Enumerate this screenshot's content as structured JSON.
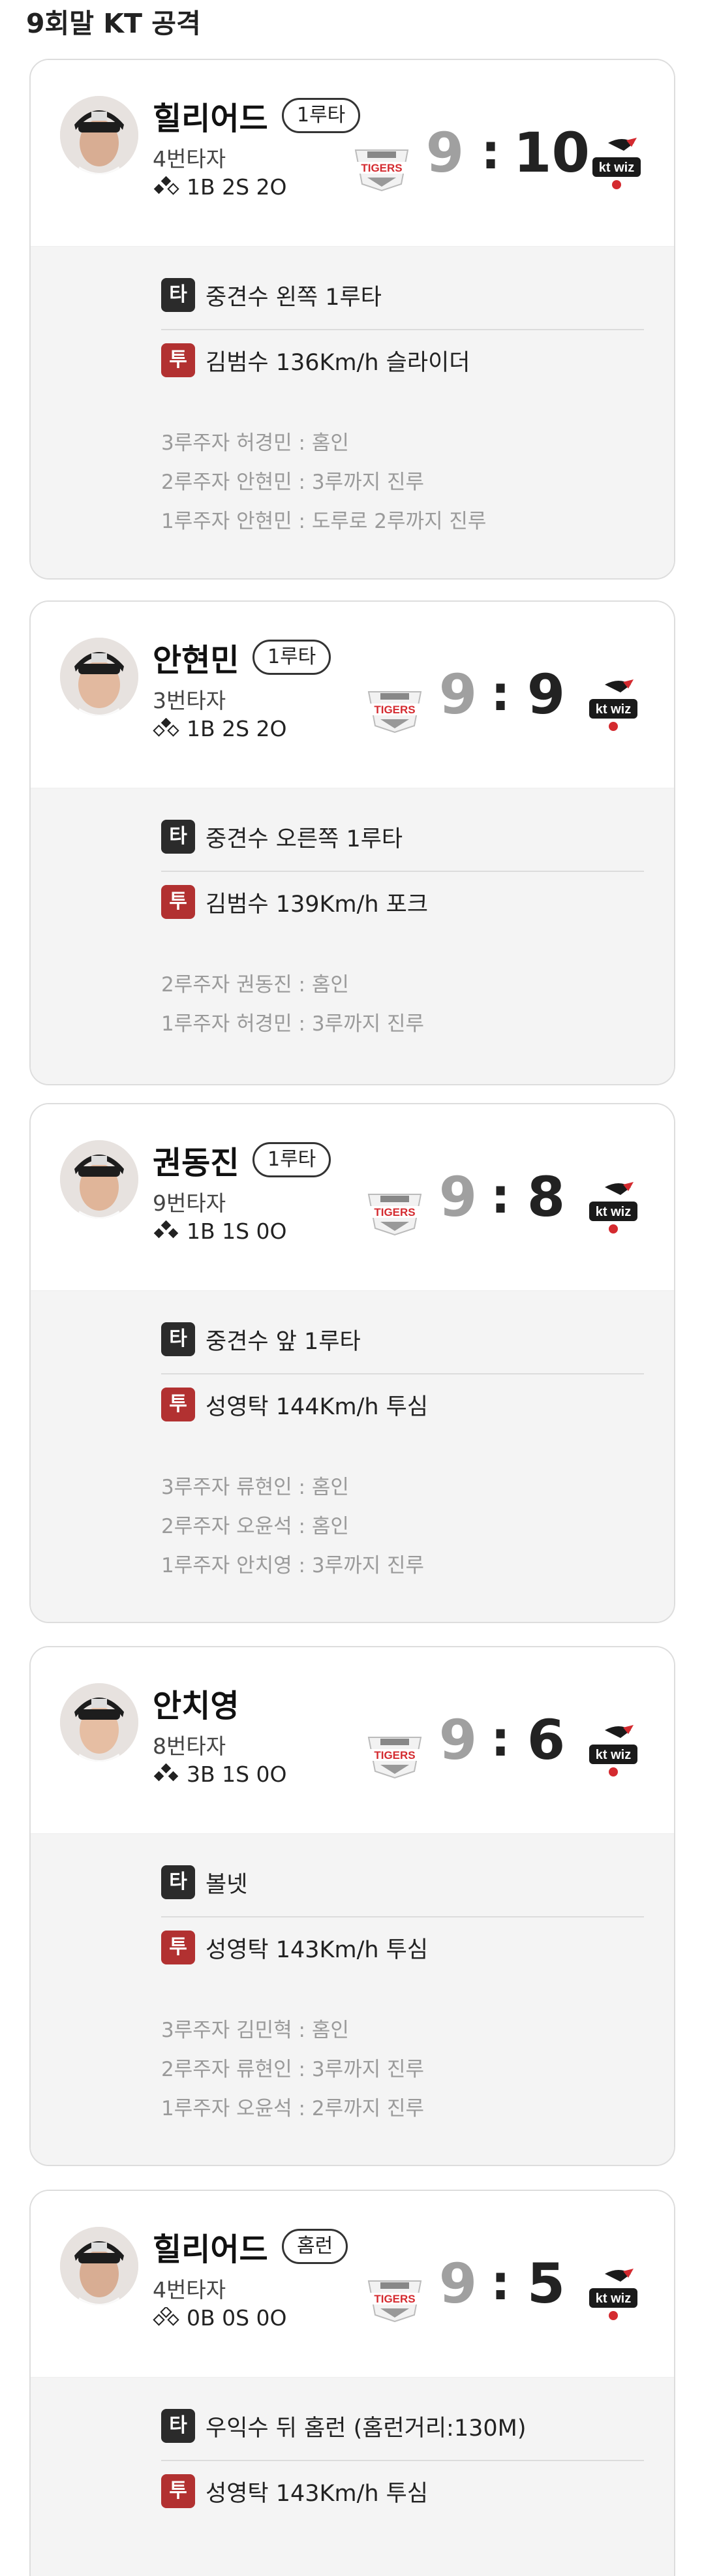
{
  "section_title": "9회말 KT 공격",
  "colors": {
    "pitch_tag": "#b23131",
    "bat_tag": "#2b2b2b",
    "home_score": "#a0a0a0",
    "away_score": "#222222",
    "tigers_red": "#d42a2f",
    "ktwiz_black": "#1a1a1a"
  },
  "cards": [
    {
      "player": "힐리어드",
      "result": "1루타",
      "order": "4번타자",
      "count": "1B 2S 2O",
      "score_home": "9",
      "score_away": "10",
      "colon": ":",
      "bat_tag": "타",
      "bat_text": "중견수 왼쪽 1루타",
      "pitch_tag": "투",
      "pitch_text": "김범수 136Km/h 슬라이더",
      "runners": [
        "3루주자 허경민 : 홈인",
        "2루주자 안현민 : 3루까지 진루",
        "1루주자 안현민 : 도루로 2루까지 진루"
      ]
    },
    {
      "player": "안현민",
      "result": "1루타",
      "order": "3번타자",
      "count": "1B 2S 2O",
      "score_home": "9",
      "score_away": "9",
      "colon": ":",
      "bat_tag": "타",
      "bat_text": "중견수 오른쪽 1루타",
      "pitch_tag": "투",
      "pitch_text": "김범수 139Km/h 포크",
      "runners": [
        "2루주자 권동진 : 홈인",
        "1루주자 허경민 : 3루까지 진루"
      ]
    },
    {
      "player": "권동진",
      "result": "1루타",
      "order": "9번타자",
      "count": "1B 1S 0O",
      "score_home": "9",
      "score_away": "8",
      "colon": ":",
      "bat_tag": "타",
      "bat_text": "중견수 앞 1루타",
      "pitch_tag": "투",
      "pitch_text": "성영탁 144Km/h 투심",
      "runners": [
        "3루주자 류현인 : 홈인",
        "2루주자 오윤석 : 홈인",
        "1루주자 안치영 : 3루까지 진루"
      ]
    },
    {
      "player": "안치영",
      "result": "",
      "order": "8번타자",
      "count": "3B 1S 0O",
      "score_home": "9",
      "score_away": "6",
      "colon": ":",
      "bat_tag": "타",
      "bat_text": "볼넷",
      "pitch_tag": "투",
      "pitch_text": "성영탁 143Km/h 투심",
      "runners": [
        "3루주자 김민혁 : 홈인",
        "2루주자 류현인 : 3루까지 진루",
        "1루주자 오윤석 : 2루까지 진루"
      ]
    },
    {
      "player": "힐리어드",
      "result": "홈런",
      "order": "4번타자",
      "count": "0B 0S 0O",
      "score_home": "9",
      "score_away": "5",
      "colon": ":",
      "bat_tag": "타",
      "bat_text": "우익수 뒤 홈런 (홈런거리:130M)",
      "pitch_tag": "투",
      "pitch_text": "성영탁 143Km/h 투심",
      "runners": []
    }
  ],
  "icons": {
    "home_team_logo": "tigers-logo",
    "away_team_logo": "ktwiz-logo",
    "base_diamond": "base-diamond-icon"
  }
}
